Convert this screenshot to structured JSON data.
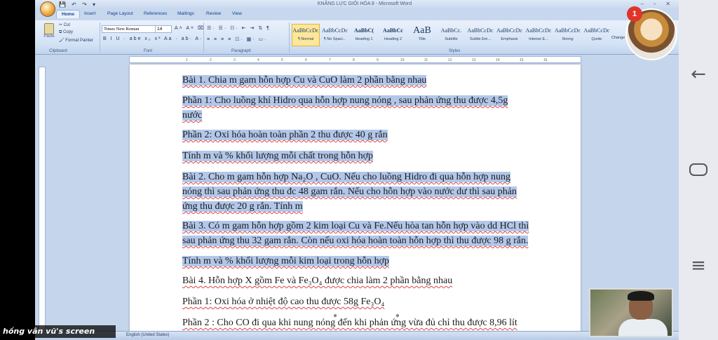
{
  "window": {
    "title": "KNĂNG LỰC GIỎI HÓA 8 - Microsoft Word",
    "qat": "💾 ↶ ↷ ▾",
    "controls": "– ▫ ✕"
  },
  "tabs": [
    "Home",
    "Insert",
    "Page Layout",
    "References",
    "Mailings",
    "Review",
    "View"
  ],
  "ribbon": {
    "clipboard": {
      "paste_label": "Paste",
      "items": [
        "Cut",
        "Copy",
        "Format Painter"
      ],
      "group_label": "Clipboard"
    },
    "font": {
      "name": "Times New Roman",
      "size": "14",
      "row1": "A˄ A˅ ⌧",
      "row2": "B I U · abe x₂ x² Aa · ab· A·",
      "group_label": "Font"
    },
    "paragraph": {
      "row1": "☰· ☰· ☷· ⇤ ⇥ ⇅ ¶",
      "row2": "≡ ≡ ≡ ≡ ☷· ▦· ▭·",
      "group_label": "Paragraph"
    },
    "styles": {
      "group_label": "Styles",
      "items": [
        {
          "sample": "AaBbCcDc",
          "name": "¶ Normal",
          "selected": true
        },
        {
          "sample": "AaBbCcDc",
          "name": "¶ No Spaci...",
          "selected": false
        },
        {
          "sample": "AaBbC(",
          "name": "Heading 1",
          "selected": false
        },
        {
          "sample": "AaBbCc",
          "name": "Heading 2",
          "selected": false
        },
        {
          "sample": "AaB",
          "name": "Title",
          "selected": false
        },
        {
          "sample": "AaBbCc.",
          "name": "Subtitle",
          "selected": false
        },
        {
          "sample": "AaBbCcDc",
          "name": "Subtle Em...",
          "selected": false
        },
        {
          "sample": "AaBbCcDc",
          "name": "Emphasis",
          "selected": false
        },
        {
          "sample": "AaBbCcDc",
          "name": "Intense E...",
          "selected": false
        },
        {
          "sample": "AaBbCcDc",
          "name": "Strong",
          "selected": false
        },
        {
          "sample": "AaBbCcDc",
          "name": "Quote",
          "selected": false
        }
      ],
      "change_label": "Change Styles"
    }
  },
  "ruler_marks": [
    "1",
    "2",
    "3",
    "4",
    "5",
    "6",
    "7",
    "8",
    "9",
    "10",
    "11",
    "12",
    "13",
    "14",
    "15",
    "16"
  ],
  "document": {
    "paragraphs": [
      {
        "text": "Bài 1. Chia  m gam hỗn hợp Cu và CuO làm 2 phần bằng nhau",
        "selected": true
      },
      {
        "text": "Phần 1: Cho luồng khí Hidro qua hỗn hợp nung nóng , sau phản ứng thu được 4,5g",
        "selected": true
      },
      {
        "text": "nước",
        "selected": true
      },
      {
        "text": "Phần 2: Oxi hóa hoàn toàn phần 2 thu được 40 g rắn",
        "selected": true
      },
      {
        "text": " Tính m và % khối lượng mỗi chất trong hỗn hợp",
        "selected": true
      },
      {
        "text": "Bài 2. Cho m gam hỗn hợp Na₂O , CuO. Nếu cho luồng Hidro đi qua hỗn hợp nung",
        "selected": true
      },
      {
        "text": "nóng thì sau phản ứng thu đc 48 gam rắn. Nếu cho hỗn hợp vào nước dư thì sau phản",
        "selected": true
      },
      {
        "text": "ứng thu được 20 g rắn. Tính m",
        "selected": true
      },
      {
        "text": "Bài 3. Có m gam hỗn hợp gồm 2 kim loại Cu và Fe.Nếu hòa tan hỗn hợp vào dd HCl thì",
        "selected": true
      },
      {
        "text": "sau phản ứng thu 32 gam rắn. Còn nếu oxi hóa hoàn toàn hỗn hợp thì thu được 98 g rắn.",
        "selected": true
      },
      {
        "text": "Tính m và % khối lượng mỗi kim loại trong hỗn hợp",
        "selected": true
      },
      {
        "text": "Bài 4. Hỗn hợp X gồm Fe và Fe₃O₄ được chia làm 2 phần bằng nhau",
        "selected": false
      },
      {
        "text": "Phần 1: Oxi hóa ở nhiệt độ cao thu được 58g Fe₃O₄",
        "selected": false
      },
      {
        "text": "Phần 2 : Cho CO đi qua khi nung nóng đến khi phản ứng vừa đủ chỉ thu được 8,96 lít",
        "selected": false
      }
    ]
  },
  "status": {
    "language": "English (United States)"
  },
  "overlay": {
    "watermark": "hồng vân vũ's screen",
    "notification_count": "1"
  },
  "android_nav": {
    "back": "←",
    "menu": "≡"
  }
}
